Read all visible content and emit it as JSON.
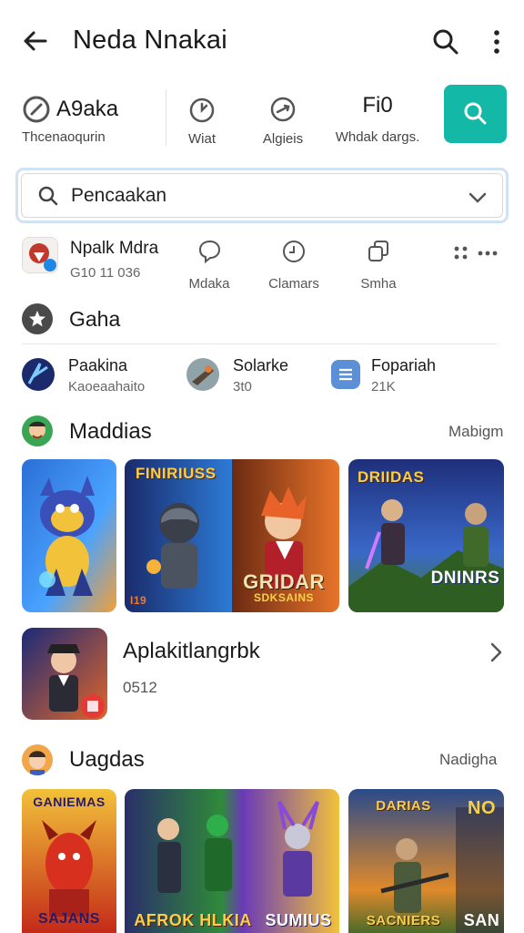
{
  "header": {
    "title": "Neda Nnakai"
  },
  "filters": {
    "f1": {
      "title": "A9aka",
      "sub": "Thcenaoqurin"
    },
    "f2": {
      "sub": "Wiat"
    },
    "f3": {
      "sub": "Algieis"
    },
    "f4": {
      "title": "Fi0",
      "sub": "Whdak dargs."
    }
  },
  "search": {
    "value": "Pencaakan"
  },
  "app": {
    "name": "Npalk Mdra",
    "id": "G10 11 036",
    "actions": [
      "Mdaka",
      "Clamars",
      "Smha"
    ]
  },
  "category": {
    "title": "Gaha"
  },
  "minis": [
    {
      "name": "Paakina",
      "sub": "Kaoeaahaito"
    },
    {
      "name": "Solarke",
      "sub": "3t0"
    },
    {
      "name": "Fopariah",
      "sub": "21K"
    }
  ],
  "section1": {
    "title": "Maddias",
    "more": "Mabigm",
    "cards": [
      {
        "caption": ""
      },
      {
        "caption_top": "FINIRIUSS",
        "caption_bottom": "GRIDAR",
        "caption_sub": "SDKSAINS",
        "badge_left": "I19"
      },
      {
        "caption_top": "DRIIDAS",
        "caption_bottom": "DNINRS",
        "caption_sub": ""
      }
    ]
  },
  "featured": {
    "title": "Aplakitlangrbk",
    "sub": "0512"
  },
  "section2": {
    "title": "Uagdas",
    "more": "Nadigha",
    "cards": [
      {
        "caption_top": "GANIEMAS",
        "caption_bottom": "SAJANS"
      },
      {
        "caption_top": "",
        "caption_bottom": "AFROK HLKIA"
      },
      {
        "caption_top": "",
        "caption_bottom": "SUMIUS"
      },
      {
        "caption_top": "DARIAS",
        "caption_bottom": "SACNIERS",
        "extra": "NO",
        "extra2": "SAN"
      }
    ]
  },
  "colors": {
    "accent": "#14b8a6",
    "field_border": "#cfe3f5"
  }
}
